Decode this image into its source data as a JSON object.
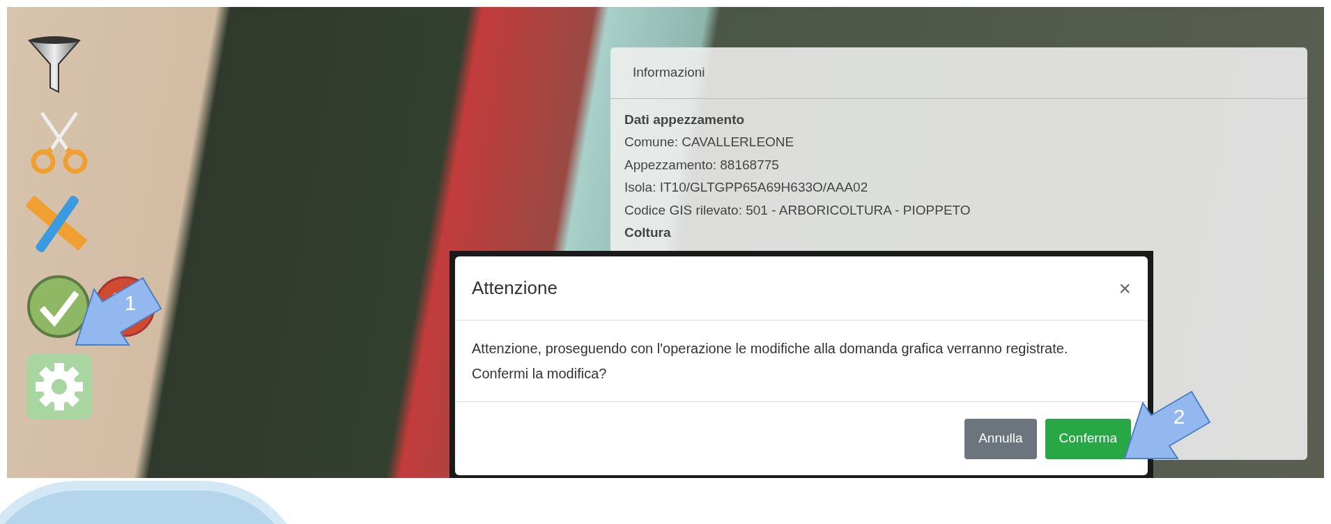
{
  "info_panel": {
    "title": "Informazioni",
    "section_title": "Dati appezzamento",
    "lines": [
      "Comune: CAVALLERLEONE",
      "Appezzamento: 88168775",
      "Isola: IT10/GLTGPP65A69H633O/AAA02",
      "Codice GIS rilevato: 501 - ARBORICOLTURA - PIOPPETO"
    ],
    "next_section_title": "Coltura"
  },
  "toolbar": [
    {
      "kind": "filter"
    },
    {
      "kind": "cut"
    },
    {
      "kind": "measure"
    },
    {
      "kind": "confirm-cancel"
    },
    {
      "kind": "settings"
    }
  ],
  "dialog": {
    "title": "Attenzione",
    "close": "×",
    "message": "Attenzione, proseguendo con l'operazione le modifiche alla domanda grafica verranno registrate. Confermi la modifica?",
    "buttons": [
      {
        "label": "Annulla",
        "kind": "secondary"
      },
      {
        "label": "Conferma",
        "kind": "primary"
      }
    ]
  },
  "callouts": [
    {
      "label": "1"
    },
    {
      "label": "2"
    }
  ]
}
